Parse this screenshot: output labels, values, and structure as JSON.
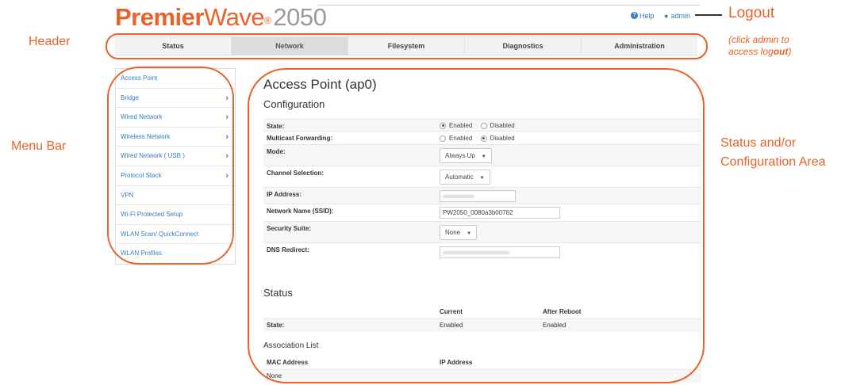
{
  "brand": {
    "part1": "Premier",
    "part2": "Wave",
    "reg": "®",
    "part3": "2050"
  },
  "toplinks": {
    "help": "Help",
    "admin": "admin"
  },
  "nav": {
    "tabs": [
      "Status",
      "Network",
      "Filesystem",
      "Diagnostics",
      "Administration"
    ],
    "active": "Network"
  },
  "sidebar": {
    "items": [
      {
        "label": "Access Point",
        "chevron": false
      },
      {
        "label": "Bridge",
        "chevron": true
      },
      {
        "label": "Wired Network",
        "chevron": true
      },
      {
        "label": "Wireless Network",
        "chevron": true
      },
      {
        "label": "Wired Network ( USB )",
        "chevron": true
      },
      {
        "label": "Protocol Stack",
        "chevron": true
      },
      {
        "label": "VPN",
        "chevron": false
      },
      {
        "label": "Wi-Fi Protected Setup",
        "chevron": false
      },
      {
        "label": "WLAN Scan/ QuickConnect",
        "chevron": false
      },
      {
        "label": "WLAN Profiles",
        "chevron": false
      }
    ]
  },
  "main": {
    "title": "Access Point (ap0)",
    "config_heading": "Configuration",
    "fields": {
      "state": {
        "label": "State:",
        "opt1": "Enabled",
        "opt2": "Disabled"
      },
      "multicast": {
        "label": "Multicast Forwarding:",
        "opt1": "Enabled",
        "opt2": "Disabled"
      },
      "mode": {
        "label": "Mode:",
        "value": "Always Up"
      },
      "channel": {
        "label": "Channel Selection:",
        "value": "Automatic"
      },
      "ip": {
        "label": "IP Address:"
      },
      "ssid": {
        "label": "Network Name (SSID):",
        "value": "PW2050_0080a3b00762"
      },
      "security": {
        "label": "Security Suite:",
        "value": "None"
      },
      "dns": {
        "label": "DNS Redirect:"
      }
    },
    "status_heading": "Status",
    "status_table": {
      "col_current": "Current",
      "col_after": "After Reboot",
      "row_label": "State:",
      "current": "Enabled",
      "after": "Enabled"
    },
    "assoc_heading": "Association List",
    "assoc_table": {
      "col_mac": "MAC Address",
      "col_ip": "IP Address",
      "empty": "None"
    }
  },
  "annotations": {
    "logout": "Logout",
    "note_line1": "(click admin to",
    "note_line2_pre": "access log",
    "note_line2_bold": "out",
    "note_line2_post": ")",
    "header": "Header",
    "menubar": "Menu Bar",
    "status_line1": "Status and/or",
    "status_line2": "Configuration Area"
  },
  "colors": {
    "accent": "#e8622a",
    "link": "#3a7cc0"
  }
}
